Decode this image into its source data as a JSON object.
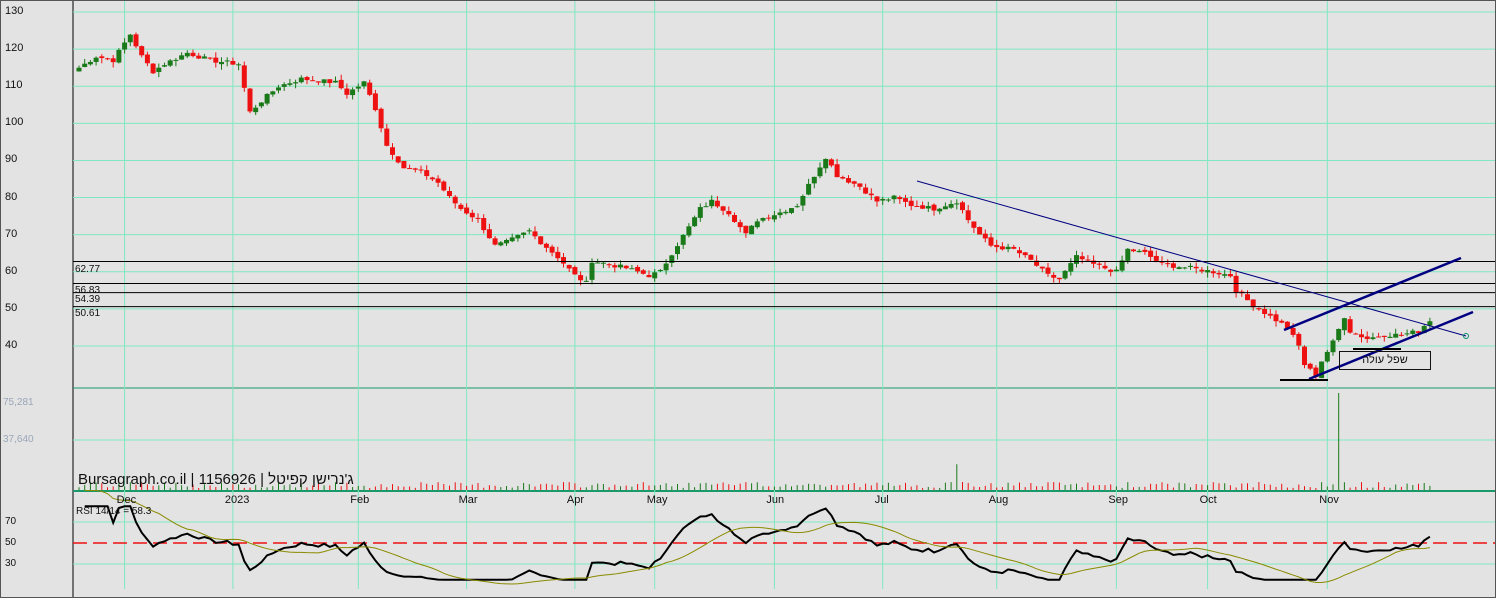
{
  "chart_data": {
    "type": "candlestick",
    "title": "Bursagraph.co.il | 1156926 | ג'נרישן קפיטל",
    "y_ticks": [
      130,
      120,
      110,
      100,
      90,
      80,
      70,
      60,
      50,
      40
    ],
    "ylim": [
      28.7,
      132
    ],
    "volume_ticks": [
      "75,281",
      "37,640"
    ],
    "x_labels": [
      "Dec",
      "2023",
      "Feb",
      "Mar",
      "Apr",
      "May",
      "Jun",
      "Jul",
      "Aug",
      "Sep",
      "Oct",
      "Nov"
    ],
    "x_label_positions_days": [
      8,
      27,
      49,
      68,
      87,
      101,
      122,
      141,
      161,
      182,
      198,
      219
    ],
    "price_path_day_close": [
      [
        0,
        115
      ],
      [
        3,
        118
      ],
      [
        6,
        117
      ],
      [
        9,
        124
      ],
      [
        11,
        118
      ],
      [
        13,
        114
      ],
      [
        15,
        116
      ],
      [
        19,
        119
      ],
      [
        23,
        117
      ],
      [
        28,
        116
      ],
      [
        30,
        103
      ],
      [
        32,
        106
      ],
      [
        35,
        110
      ],
      [
        39,
        112
      ],
      [
        45,
        111
      ],
      [
        47,
        108
      ],
      [
        50,
        111
      ],
      [
        52,
        104
      ],
      [
        54,
        94
      ],
      [
        57,
        88
      ],
      [
        60,
        87
      ],
      [
        63,
        84
      ],
      [
        65,
        80
      ],
      [
        67,
        77
      ],
      [
        70,
        74
      ],
      [
        73,
        67
      ],
      [
        75,
        68
      ],
      [
        79,
        71
      ],
      [
        81,
        68
      ],
      [
        84,
        64
      ],
      [
        87,
        59
      ],
      [
        89,
        57
      ],
      [
        90,
        63
      ],
      [
        93,
        62
      ],
      [
        96,
        61
      ],
      [
        100,
        59
      ],
      [
        102,
        60
      ],
      [
        104,
        65
      ],
      [
        107,
        72
      ],
      [
        109,
        77
      ],
      [
        111,
        79
      ],
      [
        114,
        76
      ],
      [
        117,
        70
      ],
      [
        119,
        74
      ],
      [
        123,
        76
      ],
      [
        126,
        78
      ],
      [
        129,
        86
      ],
      [
        131,
        91
      ],
      [
        133,
        86
      ],
      [
        137,
        83
      ],
      [
        140,
        79
      ],
      [
        143,
        80
      ],
      [
        146,
        78
      ],
      [
        150,
        77
      ],
      [
        154,
        79
      ],
      [
        156,
        74
      ],
      [
        158,
        70
      ],
      [
        160,
        67
      ],
      [
        164,
        66
      ],
      [
        167,
        63
      ],
      [
        170,
        59
      ],
      [
        172,
        58
      ],
      [
        175,
        64
      ],
      [
        178,
        62
      ],
      [
        182,
        60
      ],
      [
        184,
        66
      ],
      [
        187,
        65
      ],
      [
        190,
        62
      ],
      [
        195,
        61
      ],
      [
        199,
        60
      ],
      [
        202,
        59
      ],
      [
        203,
        55
      ],
      [
        206,
        51
      ],
      [
        209,
        48
      ],
      [
        212,
        45
      ],
      [
        214,
        40
      ],
      [
        215,
        35
      ],
      [
        217,
        32
      ],
      [
        218,
        36
      ],
      [
        220,
        41
      ],
      [
        222,
        48
      ],
      [
        223,
        44
      ],
      [
        226,
        42
      ],
      [
        229,
        43
      ],
      [
        232,
        43
      ],
      [
        235,
        44
      ],
      [
        237,
        47
      ]
    ],
    "volume_spikes": [
      {
        "day": 154,
        "volume": 20000
      },
      {
        "day": 221,
        "volume": 75281
      }
    ],
    "horizontal_levels": [
      {
        "value": 62.77,
        "label": "62.77"
      },
      {
        "value": 56.83,
        "label": "56.83"
      },
      {
        "value": 54.39,
        "label": "54.39"
      },
      {
        "value": 50.61,
        "label": "50.61"
      }
    ],
    "annotation": "שפל עולה",
    "rsi": {
      "label": "RSI 14/14 = 58.3",
      "period": 14,
      "value": 58.3,
      "ticks": [
        70,
        50,
        30
      ],
      "midline": 50
    }
  },
  "colors": {
    "up": "#1a7a1a",
    "down": "#ee1111",
    "grid": "#7fe8c0",
    "trend": "#000080",
    "rsi": "#000000",
    "rsi_ma": "#8a8a00",
    "midline": "#ee1111"
  }
}
